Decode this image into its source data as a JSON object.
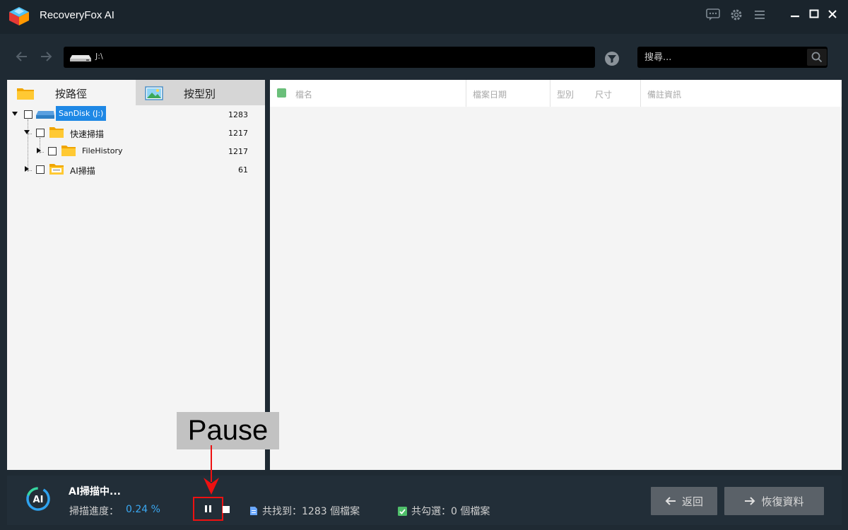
{
  "app": {
    "title": "RecoveryFox AI"
  },
  "nav": {
    "path": "J:\\",
    "search_placeholder": "搜尋..."
  },
  "tabs": [
    {
      "label": "按路徑",
      "icon": "folder-icon",
      "active": true
    },
    {
      "label": "按型別",
      "icon": "image-icon",
      "active": false
    }
  ],
  "tree": [
    {
      "label": "SanDisk (J:)",
      "count": "1283",
      "icon": "drive-icon",
      "expanded": true,
      "selected": true
    },
    {
      "label": "快速掃描",
      "count": "1217",
      "icon": "folder-icon",
      "expanded": true
    },
    {
      "label": "FileHistory",
      "count": "1217",
      "icon": "folder-icon",
      "expanded": false
    },
    {
      "label": "AI掃描",
      "count": "61",
      "icon": "ai-folder-icon",
      "expanded": false
    }
  ],
  "columns": [
    "檔名",
    "檔案日期",
    "型別",
    "尺寸",
    "備註資訊"
  ],
  "status": {
    "title": "AI掃描中...",
    "progress_label": "掃描進度：",
    "progress_value": "0.24 %",
    "found_text": "共找到：1283 個檔案",
    "checked_text": "共勾選：0 個檔案"
  },
  "buttons": {
    "back": "返回",
    "recover": "恢復資料"
  },
  "annotation": {
    "label": "Pause",
    "color": "#ee1111"
  },
  "colors": {
    "accent": "#3aa8f2",
    "selected": "#1e88e5",
    "checkbox": "#6abf7a"
  }
}
